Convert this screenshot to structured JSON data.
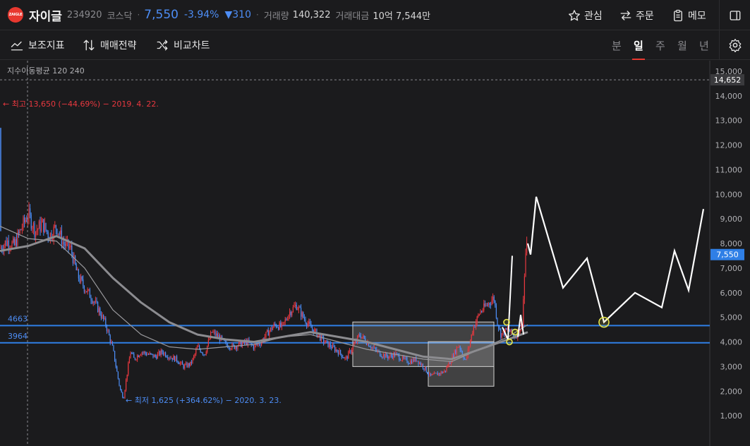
{
  "header": {
    "logo_text": "ZAIGLE",
    "stock_name": "자이글",
    "stock_code": "234920",
    "market": "코스닥",
    "price": "7,550",
    "change_pct": "-3.94%",
    "change_abs": "▼310",
    "volume_label": "거래량",
    "volume_value": "140,322",
    "amount_label": "거래대금",
    "amount_value": "10억 7,544만",
    "watch_label": "관심",
    "order_label": "주문",
    "memo_label": "메모"
  },
  "toolbar": {
    "indicator_label": "보조지표",
    "strategy_label": "매매전략",
    "compare_label": "비교차트",
    "periods": [
      "분",
      "일",
      "주",
      "월",
      "년"
    ],
    "active_period": "일"
  },
  "colors": {
    "up": "#e8383f",
    "down": "#4d8df5",
    "line_blue": "#2f7fe6",
    "background": "#1b1b1d"
  },
  "chart_data": {
    "type": "candlestick",
    "legend": "지수이동평균 120 240",
    "ylim": [
      0,
      15300
    ],
    "y_ticks": [
      "1,000",
      "2,000",
      "3,000",
      "4,000",
      "5,000",
      "6,000",
      "7,000",
      "8,000",
      "9,000",
      "10,000",
      "11,000",
      "12,000",
      "13,000",
      "14,000",
      "15,000"
    ],
    "current_price_tag": "7,550",
    "crosshair_price_tag": "14,652",
    "crosshair_price": 14652,
    "high_annotation": "← 최고 13,650 (−44.69%) − 2019. 4. 22.",
    "low_annotation": "← 최저 1,625 (+364.62%) − 2020. 3. 23.",
    "horizontal_lines": [
      {
        "label": "4663",
        "value": 4663
      },
      {
        "label": "3964",
        "value": 3964
      }
    ],
    "boxes": [
      {
        "from": 3000,
        "to": 4810,
        "x_from": 500,
        "x_to": 700
      },
      {
        "from": 2200,
        "to": 4010,
        "x_from": 607,
        "x_to": 700
      }
    ],
    "close_series": [
      [
        0,
        7800
      ],
      [
        10,
        8100
      ],
      [
        20,
        7900
      ],
      [
        30,
        8600
      ],
      [
        40,
        9200
      ],
      [
        50,
        8500
      ],
      [
        60,
        8800
      ],
      [
        70,
        8300
      ],
      [
        80,
        8700
      ],
      [
        90,
        8000
      ],
      [
        100,
        7800
      ],
      [
        110,
        6700
      ],
      [
        120,
        6200
      ],
      [
        130,
        5800
      ],
      [
        140,
        5300
      ],
      [
        150,
        4700
      ],
      [
        160,
        3700
      ],
      [
        170,
        2100
      ],
      [
        175,
        1700
      ],
      [
        180,
        2700
      ],
      [
        185,
        3600
      ],
      [
        190,
        3300
      ],
      [
        200,
        3600
      ],
      [
        210,
        3500
      ],
      [
        220,
        3400
      ],
      [
        230,
        3600
      ],
      [
        240,
        3400
      ],
      [
        250,
        3300
      ],
      [
        260,
        3000
      ],
      [
        270,
        3100
      ],
      [
        275,
        3400
      ],
      [
        280,
        3800
      ],
      [
        290,
        3500
      ],
      [
        300,
        4400
      ],
      [
        310,
        4200
      ],
      [
        320,
        3900
      ],
      [
        330,
        3800
      ],
      [
        340,
        3900
      ],
      [
        350,
        4000
      ],
      [
        360,
        3800
      ],
      [
        370,
        4000
      ],
      [
        380,
        4400
      ],
      [
        390,
        4700
      ],
      [
        400,
        4600
      ],
      [
        410,
        5200
      ],
      [
        420,
        5500
      ],
      [
        430,
        5000
      ],
      [
        440,
        4600
      ],
      [
        450,
        4300
      ],
      [
        460,
        4000
      ],
      [
        470,
        3800
      ],
      [
        480,
        3600
      ],
      [
        490,
        3300
      ],
      [
        500,
        3800
      ],
      [
        510,
        4300
      ],
      [
        520,
        4000
      ],
      [
        530,
        3700
      ],
      [
        540,
        3500
      ],
      [
        550,
        3400
      ],
      [
        560,
        3500
      ],
      [
        570,
        3300
      ],
      [
        580,
        3200
      ],
      [
        590,
        3300
      ],
      [
        600,
        3000
      ],
      [
        610,
        2600
      ],
      [
        620,
        2700
      ],
      [
        630,
        2800
      ],
      [
        640,
        3300
      ],
      [
        650,
        3900
      ],
      [
        660,
        3200
      ],
      [
        670,
        4500
      ],
      [
        680,
        5200
      ],
      [
        690,
        5500
      ],
      [
        700,
        5800
      ],
      [
        705,
        4800
      ],
      [
        710,
        4300
      ],
      [
        720,
        4500
      ],
      [
        730,
        4200
      ],
      [
        740,
        4700
      ],
      [
        745,
        7600
      ],
      [
        748,
        8000
      ]
    ],
    "ema_series": [
      {
        "name": "120",
        "values": [
          [
            0,
            8700
          ],
          [
            40,
            8200
          ],
          [
            80,
            8100
          ],
          [
            120,
            7000
          ],
          [
            160,
            5300
          ],
          [
            200,
            4300
          ],
          [
            240,
            3800
          ],
          [
            280,
            3700
          ],
          [
            320,
            3800
          ],
          [
            360,
            3900
          ],
          [
            400,
            4200
          ],
          [
            440,
            4300
          ],
          [
            480,
            4000
          ],
          [
            520,
            3700
          ],
          [
            560,
            3500
          ],
          [
            600,
            3300
          ],
          [
            640,
            3200
          ],
          [
            680,
            3700
          ],
          [
            720,
            4200
          ],
          [
            748,
            4700
          ]
        ]
      },
      {
        "name": "240",
        "values": [
          [
            0,
            7700
          ],
          [
            40,
            7900
          ],
          [
            80,
            8300
          ],
          [
            120,
            7800
          ],
          [
            160,
            6600
          ],
          [
            200,
            5600
          ],
          [
            240,
            4800
          ],
          [
            280,
            4300
          ],
          [
            320,
            4100
          ],
          [
            360,
            4000
          ],
          [
            400,
            4200
          ],
          [
            440,
            4400
          ],
          [
            480,
            4200
          ],
          [
            520,
            4000
          ],
          [
            560,
            3700
          ],
          [
            600,
            3400
          ],
          [
            640,
            3300
          ],
          [
            680,
            3700
          ],
          [
            720,
            4100
          ],
          [
            748,
            4400
          ]
        ]
      }
    ],
    "forecast_series": [
      [
        748,
        8000
      ],
      [
        752,
        7550
      ],
      [
        760,
        9900
      ],
      [
        798,
        6200
      ],
      [
        832,
        7400
      ],
      [
        856,
        4800
      ],
      [
        900,
        6000
      ],
      [
        938,
        5400
      ],
      [
        956,
        7700
      ],
      [
        976,
        6100
      ],
      [
        997,
        9400
      ]
    ],
    "marker_points": [
      [
        856,
        4800
      ],
      [
        718,
        4800
      ],
      [
        730,
        4400
      ],
      [
        722,
        4000
      ]
    ]
  }
}
